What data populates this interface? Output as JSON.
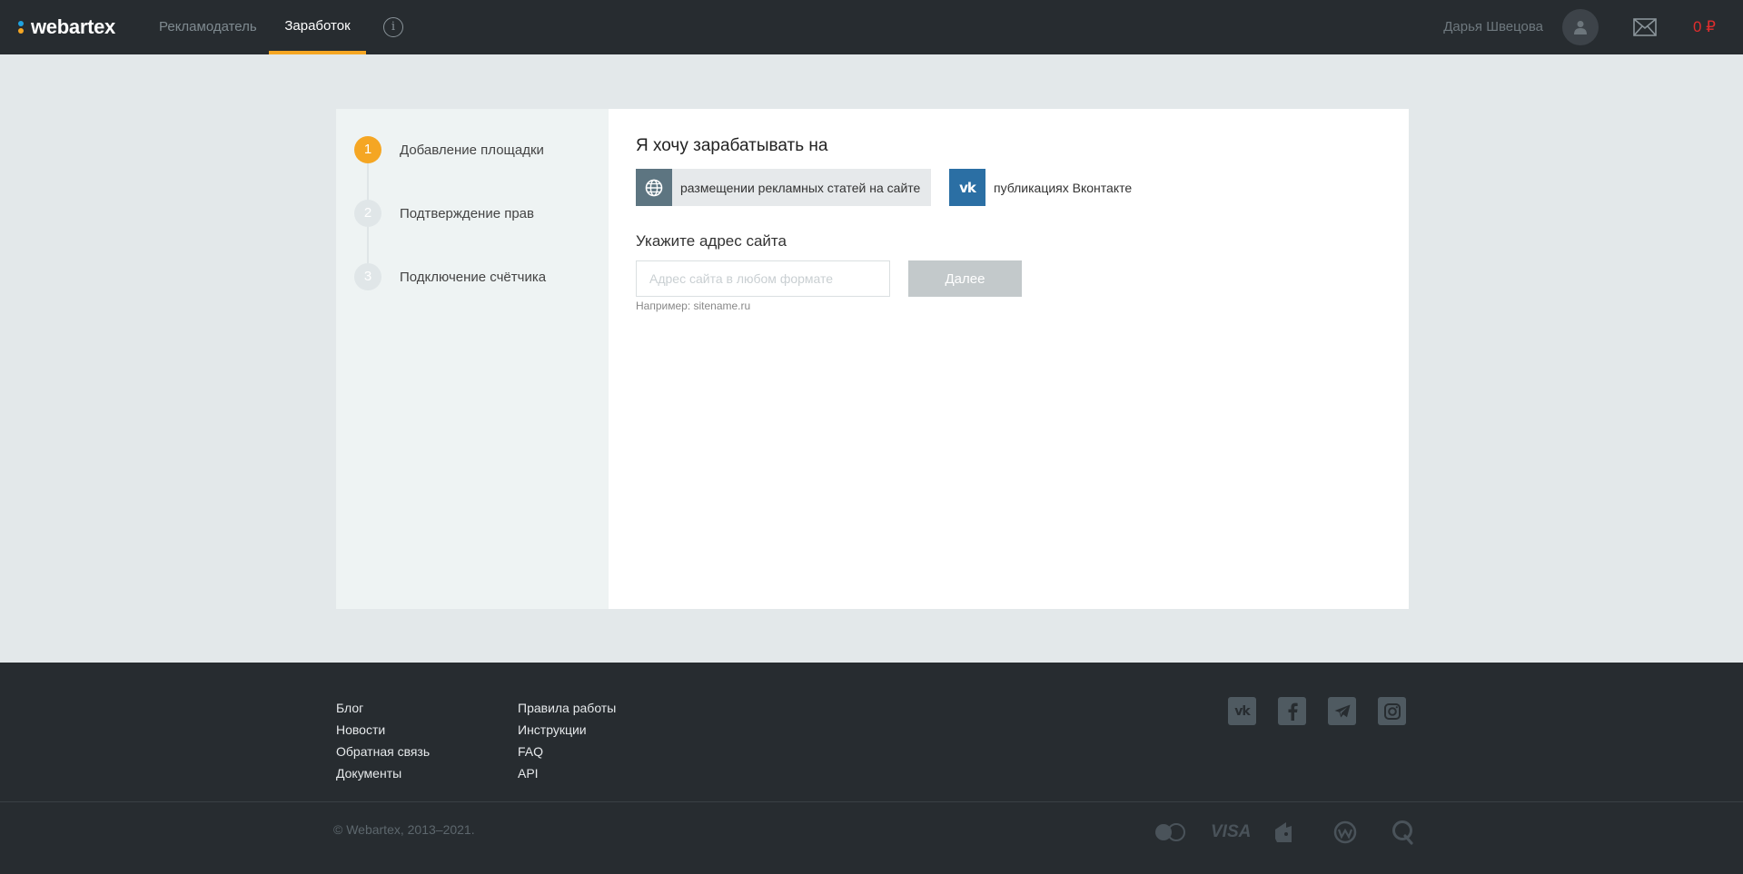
{
  "header": {
    "logo_text": "webartex",
    "nav": {
      "advertiser": "Рекламодатель",
      "earnings": "Заработок"
    },
    "info_label": "i",
    "user_name": "Дарья Швецова",
    "balance": "0 ₽"
  },
  "steps": [
    {
      "number": "1",
      "label": "Добавление площадки",
      "active": true
    },
    {
      "number": "2",
      "label": "Подтверждение прав",
      "active": false
    },
    {
      "number": "3",
      "label": "Подключение счётчика",
      "active": false
    }
  ],
  "main": {
    "title": "Я хочу зарабатывать на",
    "options": [
      {
        "label": "размещении рекламных статей на сайте",
        "icon": "globe-icon",
        "selected": true
      },
      {
        "label": "публикациях Вконтакте",
        "icon": "vk-icon",
        "selected": false
      }
    ],
    "address_title": "Укажите адрес сайта",
    "address_placeholder": "Адрес сайта в любом формате",
    "next_button": "Далее",
    "hint": "Например: sitename.ru"
  },
  "footer": {
    "col1": [
      "Блог",
      "Новости",
      "Обратная связь",
      "Документы"
    ],
    "col2": [
      "Правила работы",
      "Инструкции",
      "FAQ",
      "API"
    ],
    "social": [
      "vk-icon",
      "facebook-icon",
      "telegram-icon",
      "instagram-icon"
    ],
    "copyright": "© Webartex, 2013–2021.",
    "payments": {
      "visa_label": "VISA",
      "icons": [
        "mastercard-icon",
        "visa-icon",
        "yandex-money-icon",
        "webmoney-icon",
        "qiwi-icon"
      ]
    }
  },
  "colors": {
    "accent": "#f5a623",
    "header_bg": "#272c30",
    "balance": "#e02d2d",
    "vk": "#2b6fa4"
  }
}
